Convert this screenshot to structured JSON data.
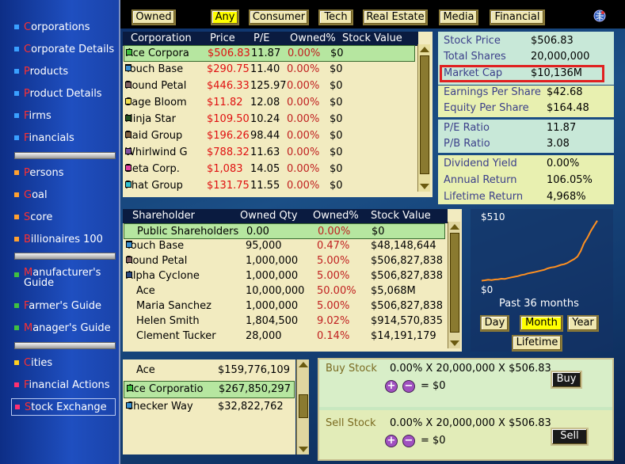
{
  "sidebar": {
    "items": [
      {
        "label": "Corporations",
        "color": "#3aa0ff"
      },
      {
        "label": "Corporate Details",
        "color": "#3aa0ff"
      },
      {
        "label": "Products",
        "color": "#3aa0ff"
      },
      {
        "label": "Product Details",
        "color": "#3aa0ff"
      },
      {
        "label": "Firms",
        "color": "#3aa0ff"
      },
      {
        "label": "Financials",
        "color": "#3aa0ff"
      },
      {
        "label": "Persons",
        "color": "#ffa030"
      },
      {
        "label": "Goal",
        "color": "#ffa030"
      },
      {
        "label": "Score",
        "color": "#ffa030"
      },
      {
        "label": "Billionaires 100",
        "color": "#ffa030"
      },
      {
        "label": "Manufacturer's Guide",
        "color": "#40c040"
      },
      {
        "label": "Farmer's Guide",
        "color": "#40c040"
      },
      {
        "label": "Manager's Guide",
        "color": "#40c040"
      },
      {
        "label": "Cities",
        "color": "#ffd020"
      },
      {
        "label": "Financial Actions",
        "color": "#ff3070"
      },
      {
        "label": "Stock Exchange",
        "color": "#ff3070"
      }
    ]
  },
  "filters": {
    "owned": "Owned",
    "any": "Any",
    "consumer": "Consumer",
    "tech": "Tech",
    "real_estate": "Real Estate",
    "media": "Media",
    "financial": "Financial"
  },
  "corp_table": {
    "headers": [
      "Corporation",
      "Price",
      "P/E",
      "Owned%",
      "Stock Value"
    ],
    "rows": [
      {
        "name": "Ace Corpora",
        "price": "$506.83",
        "pe": "11.87",
        "owned": "0.00%",
        "value": "$0",
        "color": "#40c040"
      },
      {
        "name": "Touch Base",
        "price": "$290.75",
        "pe": "11.40",
        "owned": "0.00%",
        "value": "$0",
        "color": "#3a90d0"
      },
      {
        "name": "Round Petal",
        "price": "$446.33",
        "pe": "125.97",
        "owned": "0.00%",
        "value": "$0",
        "color": "#806060"
      },
      {
        "name": "Sage Bloom",
        "price": "$11.82",
        "pe": "12.08",
        "owned": "0.00%",
        "value": "$0",
        "color": "#f0e050"
      },
      {
        "name": "Ninja Star",
        "price": "$109.50",
        "pe": "10.24",
        "owned": "0.00%",
        "value": "$0",
        "color": "#205020"
      },
      {
        "name": "Raid Group",
        "price": "$196.26",
        "pe": "98.44",
        "owned": "0.00%",
        "value": "$0",
        "color": "#806040"
      },
      {
        "name": "Whirlwind G",
        "price": "$788.32",
        "pe": "11.63",
        "owned": "0.00%",
        "value": "$0",
        "color": "#8050a0"
      },
      {
        "name": "Beta Corp.",
        "price": "$1,083",
        "pe": "14.05",
        "owned": "0.00%",
        "value": "$0",
        "color": "#e040a0"
      },
      {
        "name": "Phat Group",
        "price": "$131.75",
        "pe": "11.55",
        "owned": "0.00%",
        "value": "$0",
        "color": "#30c0d0"
      }
    ]
  },
  "stats": {
    "stock_price": {
      "k": "Stock Price",
      "v": "$506.83"
    },
    "total_shares": {
      "k": "Total Shares",
      "v": "20,000,000"
    },
    "market_cap": {
      "k": "Market Cap",
      "v": "$10,136M"
    },
    "eps": {
      "k": "Earnings Per Share",
      "v": "$42.68"
    },
    "equity_ps": {
      "k": "Equity Per Share",
      "v": "$164.48"
    },
    "pe": {
      "k": "P/E Ratio",
      "v": "11.87"
    },
    "pb": {
      "k": "P/B Ratio",
      "v": "3.08"
    },
    "div_yield": {
      "k": "Dividend Yield",
      "v": "0.00%"
    },
    "annual_return": {
      "k": "Annual Return",
      "v": "106.05%"
    },
    "lifetime_return": {
      "k": "Lifetime Return",
      "v": "4,968%"
    }
  },
  "holders_table": {
    "headers": [
      "Shareholder",
      "Owned Qty",
      "Owned%",
      "Stock Value"
    ],
    "rows": [
      {
        "name": "Public Shareholders",
        "qty": "0.00",
        "owned": "0.00%",
        "value": "$0",
        "color": ""
      },
      {
        "name": "Touch Base",
        "qty": "95,000",
        "owned": "0.47%",
        "value": "$48,148,644",
        "color": "#3a90d0"
      },
      {
        "name": "Round Petal",
        "qty": "1,000,000",
        "owned": "5.00%",
        "value": "$506,827,838",
        "color": "#806060"
      },
      {
        "name": "Alpha Cyclone",
        "qty": "1,000,000",
        "owned": "5.00%",
        "value": "$506,827,838",
        "color": "#2a4a80"
      },
      {
        "name": "Ace",
        "qty": "10,000,000",
        "owned": "50.00%",
        "value": "$5,068M",
        "color": ""
      },
      {
        "name": "Maria Sanchez",
        "qty": "1,000,000",
        "owned": "5.00%",
        "value": "$506,827,838",
        "color": ""
      },
      {
        "name": "Helen Smith",
        "qty": "1,804,500",
        "owned": "9.02%",
        "value": "$914,570,835",
        "color": ""
      },
      {
        "name": "Clement Tucker",
        "qty": "28,000",
        "owned": "0.14%",
        "value": "$14,191,179",
        "color": ""
      }
    ]
  },
  "chart": {
    "top_label": "$510",
    "bottom_label": "$0",
    "caption": "Past 36 months",
    "buttons": {
      "day": "Day",
      "month": "Month",
      "year": "Year",
      "lifetime": "Lifetime"
    },
    "line_color": "#ff9020"
  },
  "chart_data": {
    "type": "line",
    "title": "",
    "xlabel": "Past 36 months",
    "ylabel": "",
    "ylim": [
      0,
      510
    ],
    "x": [
      1,
      2,
      3,
      4,
      5,
      6,
      7,
      8,
      9,
      10,
      11,
      12,
      13,
      14,
      15,
      16,
      17,
      18,
      19,
      20,
      21,
      22,
      23,
      24,
      25,
      26,
      27,
      28,
      29,
      30,
      31,
      32,
      33,
      34,
      35,
      36
    ],
    "series": [
      {
        "name": "",
        "values": [
          15,
          18,
          22,
          20,
          24,
          26,
          30,
          28,
          35,
          40,
          45,
          50,
          58,
          62,
          70,
          75,
          80,
          86,
          92,
          98,
          108,
          115,
          118,
          126,
          135,
          140,
          150,
          165,
          178,
          198,
          240,
          300,
          340,
          390,
          430,
          470
        ]
      }
    ]
  },
  "cash_table": {
    "rows": [
      {
        "name": "Ace",
        "value": "$159,776,109",
        "color": ""
      },
      {
        "name": "Ace Corporatio",
        "value": "$267,850,297",
        "color": "#40c040"
      },
      {
        "name": "Checker Way",
        "value": "$32,822,762",
        "color": "#3a90d0"
      }
    ]
  },
  "trade": {
    "buy": {
      "label": "Buy Stock",
      "formula": "0.00% X 20,000,000 X $506.83",
      "result": "= $0",
      "button": "Buy"
    },
    "sell": {
      "label": "Sell Stock",
      "formula": "0.00% X 20,000,000 X $506.83",
      "result": "= $0",
      "button": "Sell"
    },
    "plus": "+",
    "minus": "−"
  }
}
